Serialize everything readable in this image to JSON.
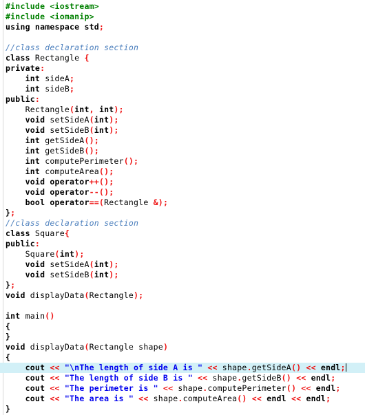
{
  "editor": {
    "language": "C++",
    "current_line_index": 35,
    "caret_visible": true,
    "colors": {
      "background": "#ffffff",
      "preprocessor": "#008000",
      "comment": "#4a7ebc",
      "keyword": "#000000",
      "punctuation": "#ee1111",
      "string": "#0000ee",
      "identifier": "#000000",
      "current_line_highlight": "#d2f0f7",
      "left_rule": "#d6d6d6"
    }
  },
  "code_lines": [
    {
      "tokens": [
        {
          "t": "pre",
          "s": "#include <iostream>"
        }
      ]
    },
    {
      "tokens": [
        {
          "t": "pre",
          "s": "#include <iomanip>"
        }
      ]
    },
    {
      "tokens": [
        {
          "t": "kw",
          "s": "using namespace std"
        },
        {
          "t": "pun",
          "s": ";"
        }
      ]
    },
    {
      "tokens": []
    },
    {
      "tokens": [
        {
          "t": "cmt",
          "s": "//class declaration section"
        }
      ]
    },
    {
      "tokens": [
        {
          "t": "kw",
          "s": "class"
        },
        {
          "t": "id",
          "s": " Rectangle "
        },
        {
          "t": "pun",
          "s": "{"
        }
      ]
    },
    {
      "tokens": [
        {
          "t": "kw",
          "s": "private"
        },
        {
          "t": "pun",
          "s": ":"
        }
      ]
    },
    {
      "tokens": [
        {
          "t": "kw",
          "s": "    int"
        },
        {
          "t": "id",
          "s": " sideA"
        },
        {
          "t": "pun",
          "s": ";"
        }
      ]
    },
    {
      "tokens": [
        {
          "t": "kw",
          "s": "    int"
        },
        {
          "t": "id",
          "s": " sideB"
        },
        {
          "t": "pun",
          "s": ";"
        }
      ]
    },
    {
      "tokens": [
        {
          "t": "kw",
          "s": "public"
        },
        {
          "t": "pun",
          "s": ":"
        }
      ]
    },
    {
      "tokens": [
        {
          "t": "id",
          "s": "    Rectangle"
        },
        {
          "t": "pun",
          "s": "("
        },
        {
          "t": "kw",
          "s": "int"
        },
        {
          "t": "pun",
          "s": ", "
        },
        {
          "t": "kw",
          "s": "int"
        },
        {
          "t": "pun",
          "s": ");"
        }
      ]
    },
    {
      "tokens": [
        {
          "t": "kw",
          "s": "    void"
        },
        {
          "t": "id",
          "s": " setSideA"
        },
        {
          "t": "pun",
          "s": "("
        },
        {
          "t": "kw",
          "s": "int"
        },
        {
          "t": "pun",
          "s": ");"
        }
      ]
    },
    {
      "tokens": [
        {
          "t": "kw",
          "s": "    void"
        },
        {
          "t": "id",
          "s": " setSideB"
        },
        {
          "t": "pun",
          "s": "("
        },
        {
          "t": "kw",
          "s": "int"
        },
        {
          "t": "pun",
          "s": ");"
        }
      ]
    },
    {
      "tokens": [
        {
          "t": "kw",
          "s": "    int"
        },
        {
          "t": "id",
          "s": " getSideA"
        },
        {
          "t": "pun",
          "s": "();"
        }
      ]
    },
    {
      "tokens": [
        {
          "t": "kw",
          "s": "    int"
        },
        {
          "t": "id",
          "s": " getSideB"
        },
        {
          "t": "pun",
          "s": "();"
        }
      ]
    },
    {
      "tokens": [
        {
          "t": "kw",
          "s": "    int"
        },
        {
          "t": "id",
          "s": " computePerimeter"
        },
        {
          "t": "pun",
          "s": "();"
        }
      ]
    },
    {
      "tokens": [
        {
          "t": "kw",
          "s": "    int"
        },
        {
          "t": "id",
          "s": " computeArea"
        },
        {
          "t": "pun",
          "s": "();"
        }
      ]
    },
    {
      "tokens": [
        {
          "t": "kw",
          "s": "    void operator"
        },
        {
          "t": "pun",
          "s": "++();"
        }
      ]
    },
    {
      "tokens": [
        {
          "t": "kw",
          "s": "    void operator"
        },
        {
          "t": "pun",
          "s": "--();"
        }
      ]
    },
    {
      "tokens": [
        {
          "t": "kw",
          "s": "    bool operator"
        },
        {
          "t": "pun",
          "s": "==("
        },
        {
          "t": "id",
          "s": "Rectangle "
        },
        {
          "t": "pun",
          "s": "&);"
        }
      ]
    },
    {
      "tokens": [
        {
          "t": "kw",
          "s": "}"
        },
        {
          "t": "pun",
          "s": ";"
        }
      ]
    },
    {
      "tokens": [
        {
          "t": "cmt",
          "s": "//class declaration section"
        }
      ]
    },
    {
      "tokens": [
        {
          "t": "kw",
          "s": "class"
        },
        {
          "t": "id",
          "s": " Square"
        },
        {
          "t": "pun",
          "s": "{"
        }
      ]
    },
    {
      "tokens": [
        {
          "t": "kw",
          "s": "public"
        },
        {
          "t": "pun",
          "s": ":"
        }
      ]
    },
    {
      "tokens": [
        {
          "t": "id",
          "s": "    Square"
        },
        {
          "t": "pun",
          "s": "("
        },
        {
          "t": "kw",
          "s": "int"
        },
        {
          "t": "pun",
          "s": ");"
        }
      ]
    },
    {
      "tokens": [
        {
          "t": "kw",
          "s": "    void"
        },
        {
          "t": "id",
          "s": " setSideA"
        },
        {
          "t": "pun",
          "s": "("
        },
        {
          "t": "kw",
          "s": "int"
        },
        {
          "t": "pun",
          "s": ");"
        }
      ]
    },
    {
      "tokens": [
        {
          "t": "kw",
          "s": "    void"
        },
        {
          "t": "id",
          "s": " setSideB"
        },
        {
          "t": "pun",
          "s": "("
        },
        {
          "t": "kw",
          "s": "int"
        },
        {
          "t": "pun",
          "s": ");"
        }
      ]
    },
    {
      "tokens": [
        {
          "t": "kw",
          "s": "}"
        },
        {
          "t": "pun",
          "s": ";"
        }
      ]
    },
    {
      "tokens": [
        {
          "t": "kw",
          "s": "void"
        },
        {
          "t": "id",
          "s": " displayData"
        },
        {
          "t": "pun",
          "s": "("
        },
        {
          "t": "id",
          "s": "Rectangle"
        },
        {
          "t": "pun",
          "s": ");"
        }
      ]
    },
    {
      "tokens": []
    },
    {
      "tokens": [
        {
          "t": "kw",
          "s": "int"
        },
        {
          "t": "id",
          "s": " main"
        },
        {
          "t": "pun",
          "s": "()"
        }
      ]
    },
    {
      "tokens": [
        {
          "t": "kw",
          "s": "{"
        }
      ]
    },
    {
      "tokens": [
        {
          "t": "kw",
          "s": "}"
        }
      ]
    },
    {
      "tokens": [
        {
          "t": "kw",
          "s": "void"
        },
        {
          "t": "id",
          "s": " displayData"
        },
        {
          "t": "pun",
          "s": "("
        },
        {
          "t": "id",
          "s": "Rectangle shape"
        },
        {
          "t": "pun",
          "s": ")"
        }
      ]
    },
    {
      "tokens": [
        {
          "t": "kw",
          "s": "{"
        }
      ]
    },
    {
      "tokens": [
        {
          "t": "kw",
          "s": "    cout"
        },
        {
          "t": "pun",
          "s": " << "
        },
        {
          "t": "str",
          "s": "\"\\nThe length of side A is \""
        },
        {
          "t": "pun",
          "s": " << "
        },
        {
          "t": "id",
          "s": "shape"
        },
        {
          "t": "pun",
          "s": "."
        },
        {
          "t": "id",
          "s": "getSideA"
        },
        {
          "t": "pun",
          "s": "()"
        },
        {
          "t": "pun",
          "s": " << "
        },
        {
          "t": "kw",
          "s": "endl"
        },
        {
          "t": "pun",
          "s": ";"
        }
      ]
    },
    {
      "tokens": [
        {
          "t": "kw",
          "s": "    cout"
        },
        {
          "t": "pun",
          "s": " << "
        },
        {
          "t": "str",
          "s": "\"The length of side B is \""
        },
        {
          "t": "pun",
          "s": " << "
        },
        {
          "t": "id",
          "s": "shape"
        },
        {
          "t": "pun",
          "s": "."
        },
        {
          "t": "id",
          "s": "getSideB"
        },
        {
          "t": "pun",
          "s": "()"
        },
        {
          "t": "pun",
          "s": " << "
        },
        {
          "t": "kw",
          "s": "endl"
        },
        {
          "t": "pun",
          "s": ";"
        }
      ]
    },
    {
      "tokens": [
        {
          "t": "kw",
          "s": "    cout"
        },
        {
          "t": "pun",
          "s": " << "
        },
        {
          "t": "str",
          "s": "\"The perimeter is \""
        },
        {
          "t": "pun",
          "s": " << "
        },
        {
          "t": "id",
          "s": "shape"
        },
        {
          "t": "pun",
          "s": "."
        },
        {
          "t": "id",
          "s": "computePerimeter"
        },
        {
          "t": "pun",
          "s": "()"
        },
        {
          "t": "pun",
          "s": " << "
        },
        {
          "t": "kw",
          "s": "endl"
        },
        {
          "t": "pun",
          "s": ";"
        }
      ]
    },
    {
      "tokens": [
        {
          "t": "kw",
          "s": "    cout"
        },
        {
          "t": "pun",
          "s": " << "
        },
        {
          "t": "str",
          "s": "\"The area is \""
        },
        {
          "t": "pun",
          "s": " << "
        },
        {
          "t": "id",
          "s": "shape"
        },
        {
          "t": "pun",
          "s": "."
        },
        {
          "t": "id",
          "s": "computeArea"
        },
        {
          "t": "pun",
          "s": "()"
        },
        {
          "t": "pun",
          "s": " << "
        },
        {
          "t": "kw",
          "s": "endl"
        },
        {
          "t": "pun",
          "s": " << "
        },
        {
          "t": "kw",
          "s": "endl"
        },
        {
          "t": "pun",
          "s": ";"
        }
      ]
    },
    {
      "tokens": [
        {
          "t": "kw",
          "s": "}"
        }
      ]
    }
  ]
}
